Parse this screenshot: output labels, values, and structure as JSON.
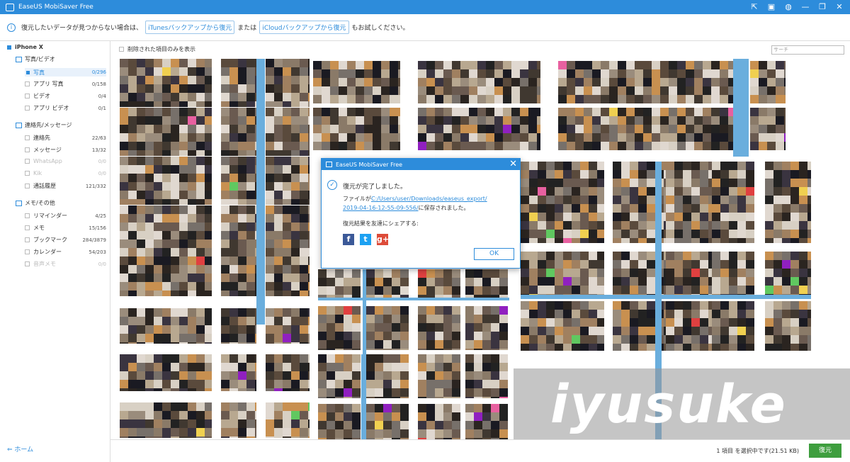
{
  "app": {
    "title": "EaseUS MobiSaver Free"
  },
  "infobar": {
    "text_before": "復元したいデータが見つからない場合は、",
    "itunes_btn": "iTunesバックアップから復元",
    "middle": "または",
    "icloud_btn": "iCloudバックアップから復元",
    "text_after": "もお試しください。"
  },
  "sidebar": {
    "device": "iPhone X",
    "groups": [
      {
        "label": "写真/ビデオ",
        "items": [
          {
            "label": "写真",
            "count": "0/296",
            "selected": true
          },
          {
            "label": "アプリ 写真",
            "count": "0/158"
          },
          {
            "label": "ビデオ",
            "count": "0/4"
          },
          {
            "label": "アプリ ビデオ",
            "count": "0/1"
          }
        ]
      },
      {
        "label": "連絡先/メッセージ",
        "items": [
          {
            "label": "連絡先",
            "count": "22/63"
          },
          {
            "label": "メッセージ",
            "count": "13/32"
          },
          {
            "label": "WhatsApp",
            "count": "0/0",
            "disabled": true
          },
          {
            "label": "Kik",
            "count": "0/0",
            "disabled": true
          },
          {
            "label": "通話履歴",
            "count": "121/332"
          }
        ]
      },
      {
        "label": "メモ/その他",
        "items": [
          {
            "label": "リマインダー",
            "count": "4/25"
          },
          {
            "label": "メモ",
            "count": "15/156"
          },
          {
            "label": "ブックマーク",
            "count": "284/3879"
          },
          {
            "label": "カレンダー",
            "count": "54/203"
          },
          {
            "label": "音声メモ",
            "count": "0/0",
            "disabled": true
          }
        ]
      }
    ],
    "home": "ホーム"
  },
  "toolbar": {
    "filter_label": "削除された項目のみを表示",
    "search_placeholder": "サーチ"
  },
  "footer": {
    "selection": "1 項目 を選択中です(21.51 KB)",
    "restore": "復元"
  },
  "dialog": {
    "title": "EaseUS MobiSaver Free",
    "done": "復元が完了しました。",
    "file_prefix": "ファイルが",
    "path_line1": "C:/Users/user/Downloads/easeus_export/",
    "path_line2": "2019-04-16-12-55-09-556/",
    "file_suffix": "に保存されました。",
    "share": "復元結果を友達にシェアする:",
    "ok": "OK"
  },
  "watermark": "iyusuke",
  "colors": {
    "accent": "#2d8cdb",
    "restore_green": "#3e9e3e"
  }
}
